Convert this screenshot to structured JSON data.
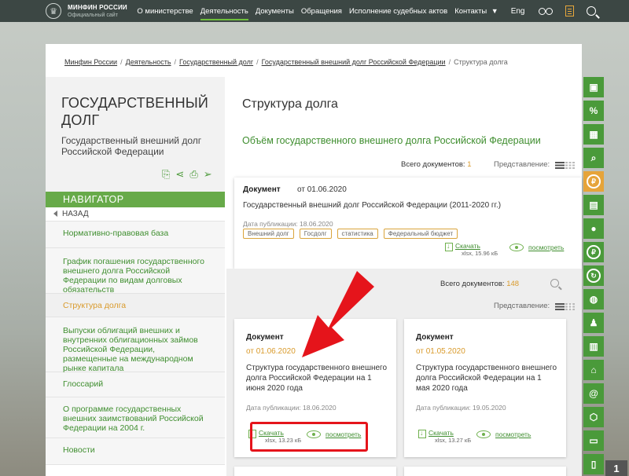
{
  "topbar": {
    "logo_title": "МИНФИН РОССИИ",
    "logo_sub": "Официальный сайт",
    "nav": [
      "О министерстве",
      "Деятельность",
      "Документы",
      "Обращения",
      "Исполнение судебных актов",
      "Контакты"
    ],
    "lang": "Eng"
  },
  "breadcrumb": {
    "items": [
      "Минфин России",
      "Деятельность",
      "Государственный долг",
      "Государственный внешний долг Российской Федерации"
    ],
    "current": "Структура долга",
    "sep": "/"
  },
  "sidebar": {
    "title": "ГОСУДАРСТВЕННЫЙ ДОЛГ",
    "subtitle": "Государственный внешний долг Российской Федерации",
    "navigator": "НАВИГАТОР",
    "back": "НАЗАД",
    "items": [
      "Нормативно-правовая база",
      "График погашения государственного внешнего долга Российской Федерации по видам долговых обязательств",
      "Структура долга",
      "Выпуски облигаций внешних и внутренних облигационных займов Российской Федерации, размещенные на международном рынке капитала",
      "Глоссарий",
      "О программе государственных внешних заимствований Российской Федерации на 2004 г.",
      "Новости"
    ]
  },
  "content": {
    "page_title": "Структура долга",
    "section_title": "Объём государственного внешнего долга Российской Федерации",
    "total_label_1": "Всего документов:",
    "total_value_1": "1",
    "view_label": "Представление:",
    "top_card": {
      "type": "Документ",
      "date": "от 01.06.2020",
      "name": "Государственный внешний долг Российской Федерации (2011-2020 гг.)",
      "pub": "Дата публикации: 18.06.2020",
      "tags": [
        "Внешний долг",
        "Госдолг",
        "статистика",
        "Федеральный бюджет"
      ],
      "download": "Скачать",
      "size": "xlsx, 15.96 кБ",
      "view": "посмотреть"
    },
    "total_label_2": "Всего документов:",
    "total_value_2": "148",
    "cards": [
      {
        "type": "Документ",
        "date": "от 01.06.2020",
        "name": "Структура государственного внешнего долга Российской Федерации на 1 июня 2020 года",
        "pub": "Дата публикации: 18.06.2020",
        "download": "Скачать",
        "size": "xlsx, 13.23 кБ",
        "view": "посмотреть"
      },
      {
        "type": "Документ",
        "date": "от 01.05.2020",
        "name": "Структура государственного внешнего долга Российской Федерации на 1 мая 2020 года",
        "pub": "Дата публикации: 19.05.2020",
        "download": "Скачать",
        "size": "xlsx, 13.27 кБ",
        "view": "посмотреть"
      }
    ]
  },
  "side_tools": {
    "icons": [
      "briefcase-icon",
      "percent-icon",
      "calculator-icon",
      "document-search-icon",
      "ruble-icon",
      "id-card-icon",
      "money-bag-icon",
      "coin-icon",
      "coin-arrow-icon",
      "globe-icon",
      "people-icon",
      "chart-icon",
      "building-icon",
      "email-icon",
      "hexagon-icon",
      "presentation-icon",
      "id-badge-icon"
    ],
    "page_number": "1"
  },
  "colors": {
    "accent_green": "#67aa49",
    "link_green": "#3f8e2f",
    "orange": "#d99a2b",
    "highlight_red": "#e5141b",
    "topbar": "#3c4744"
  }
}
